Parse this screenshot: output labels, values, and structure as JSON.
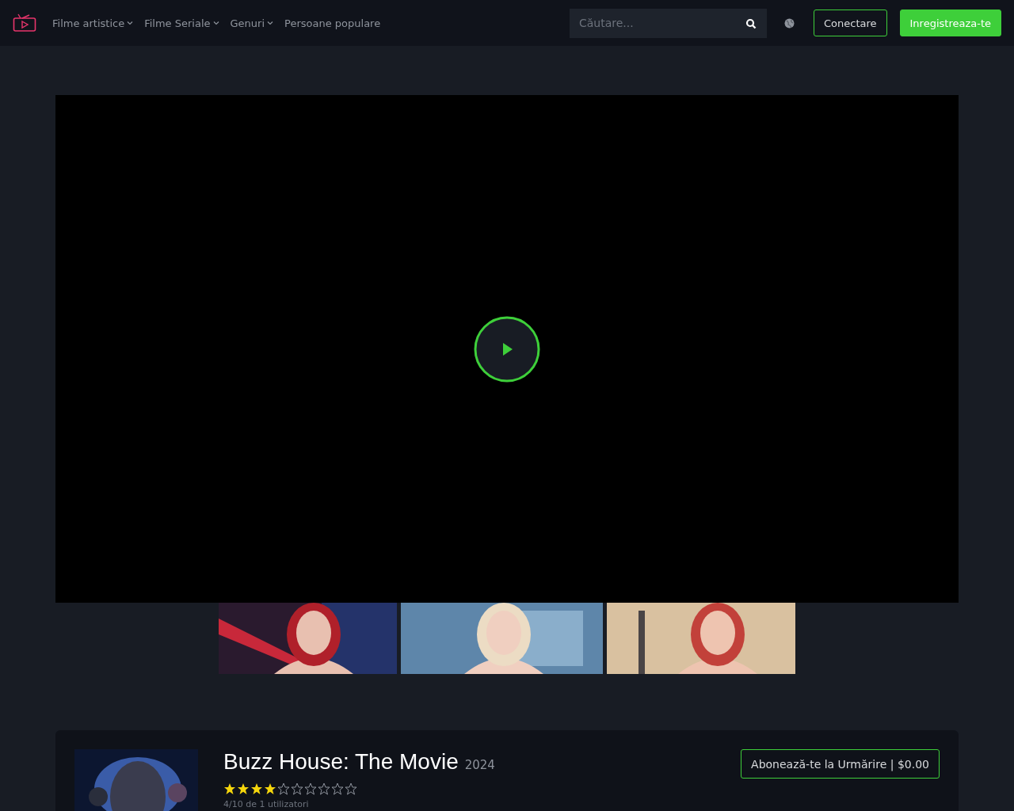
{
  "nav": {
    "items": [
      {
        "label": "Filme artistice",
        "dropdown": true
      },
      {
        "label": "Filme Seriale",
        "dropdown": true
      },
      {
        "label": "Genuri",
        "dropdown": true
      },
      {
        "label": "Persoane populare",
        "dropdown": false
      }
    ]
  },
  "search": {
    "placeholder": "Căutare..."
  },
  "buttons": [
    {
      "label": "Conectare",
      "kind": "outline"
    },
    {
      "label": "Inregistreaza-te",
      "kind": "filled"
    }
  ],
  "movie": {
    "title": "Buzz House: The Movie",
    "year": "2024",
    "stars": 4,
    "rating_text": "4/10 de 1 utilizatori",
    "subscribe": "Abonează-te la Urmărire | $0.00"
  }
}
